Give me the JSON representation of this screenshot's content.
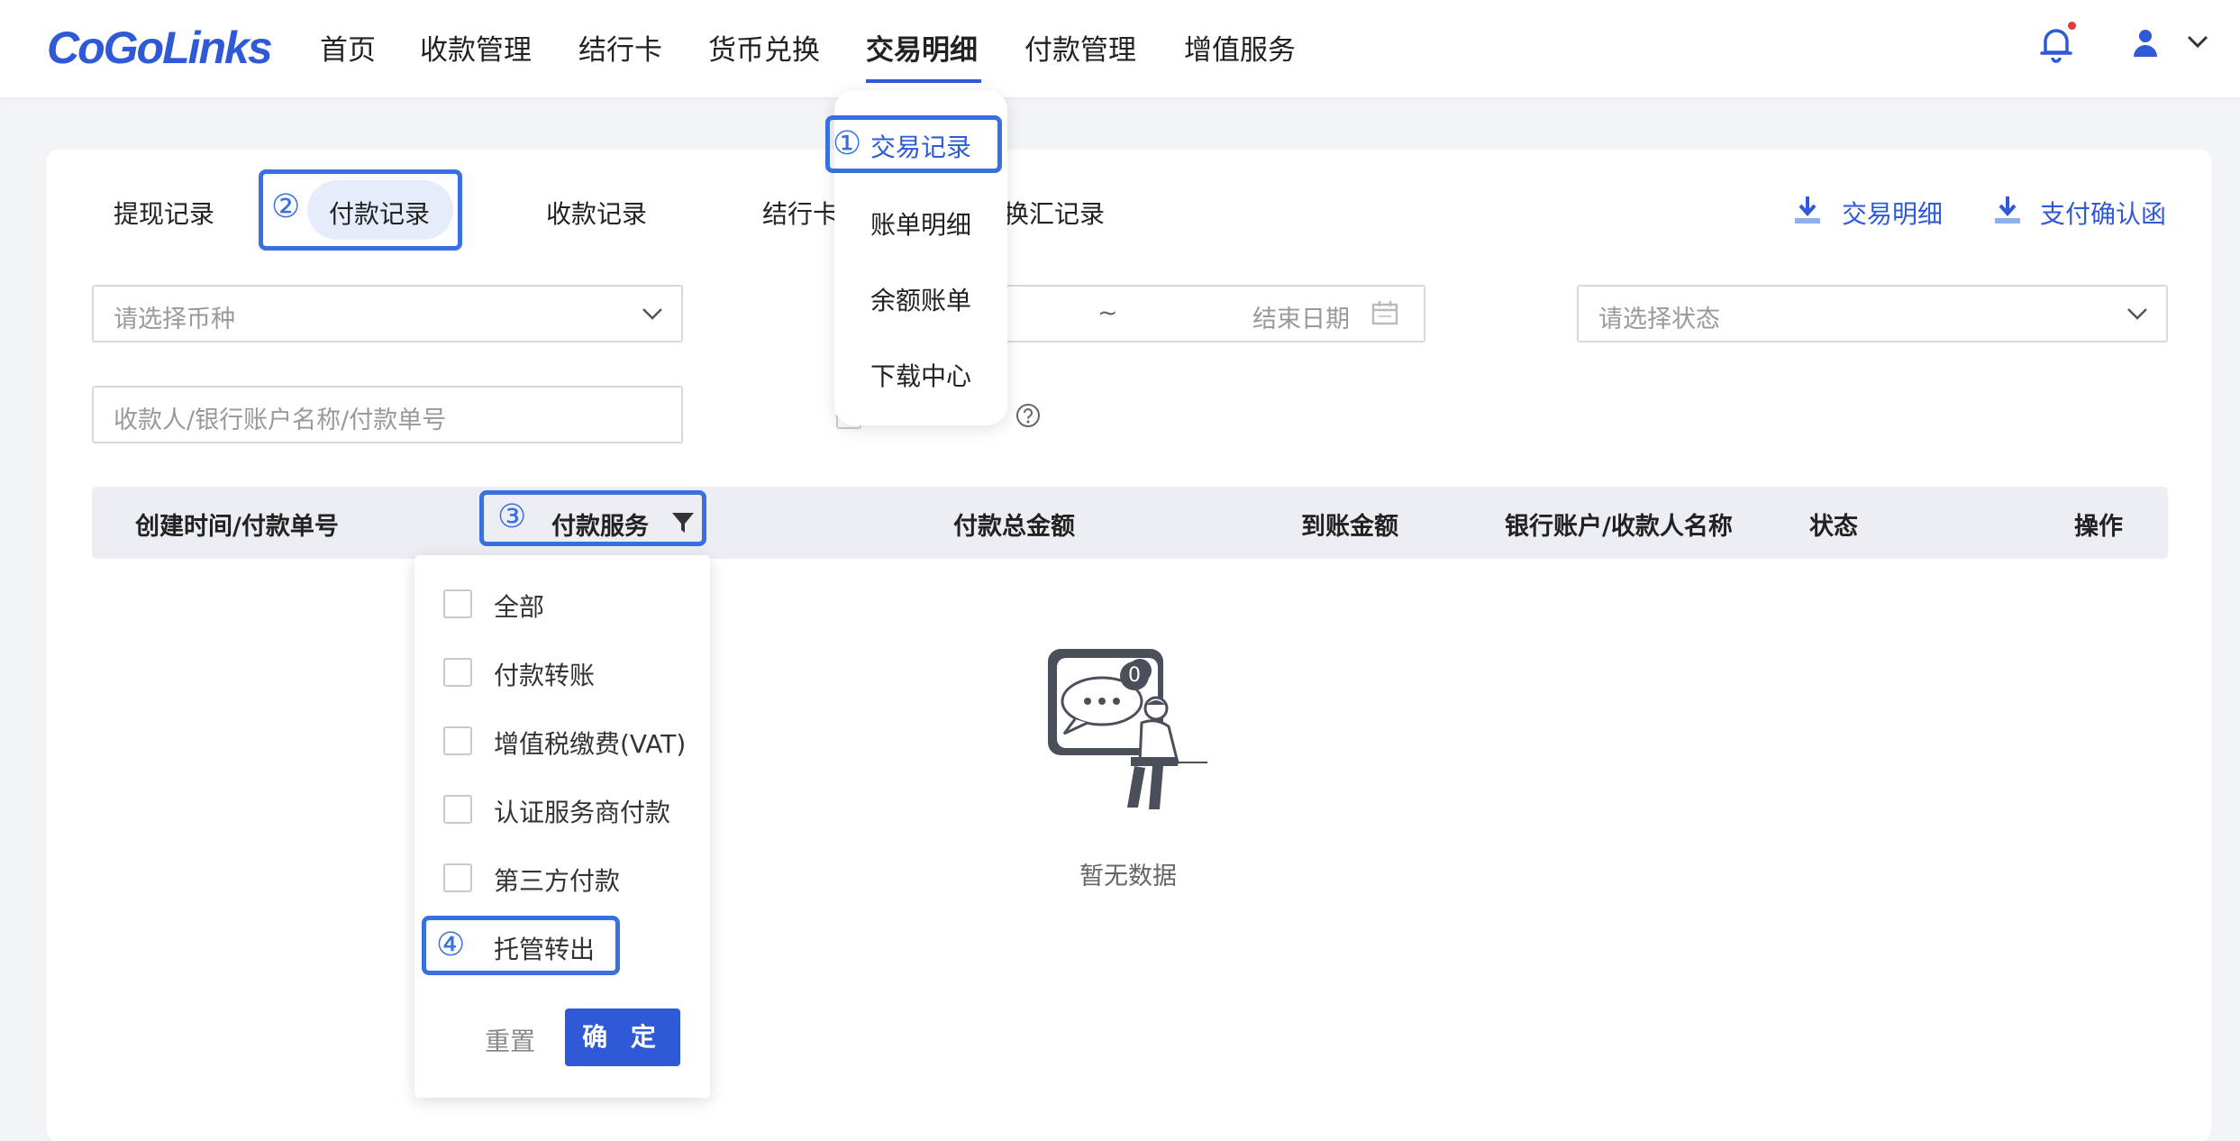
{
  "header": {
    "logo": "CoGoLinks",
    "nav": [
      "首页",
      "收款管理",
      "结行卡",
      "货币兑换",
      "交易明细",
      "付款管理",
      "增值服务"
    ],
    "active_nav": "交易明细"
  },
  "tabs": {
    "withdraw": "提现记录",
    "payment": "付款记录",
    "receive": "收款记录",
    "card": "结行卡",
    "exchange": "换汇记录"
  },
  "downloads": {
    "transaction_detail": "交易明细",
    "payment_confirm": "支付确认函"
  },
  "filters": {
    "currency_placeholder": "请选择币种",
    "date_separator": "~",
    "end_date_placeholder": "结束日期",
    "status_placeholder": "请选择状态",
    "search_placeholder": "收款人/银行账户名称/付款单号"
  },
  "table": {
    "headers": [
      "创建时间/付款单号",
      "付款服务",
      "付款总金额",
      "到账金额",
      "银行账户/收款人名称",
      "状态",
      "操作"
    ],
    "empty_text": "暂无数据",
    "badge_count": "0"
  },
  "menu": {
    "items": [
      "交易记录",
      "账单明细",
      "余额账单",
      "下载中心"
    ]
  },
  "filter_popup": {
    "options": [
      "全部",
      "付款转账",
      "增值税缴费(VAT)",
      "认证服务商付款",
      "第三方付款",
      "托管转出"
    ],
    "reset": "重置",
    "confirm": "确 定"
  },
  "annotations": {
    "a1": "①",
    "a2": "②",
    "a3": "③",
    "a4": "④"
  },
  "colors": {
    "accent": "#2f59d6",
    "annotation": "#3a6fe0",
    "notify": "#e03a3a"
  }
}
